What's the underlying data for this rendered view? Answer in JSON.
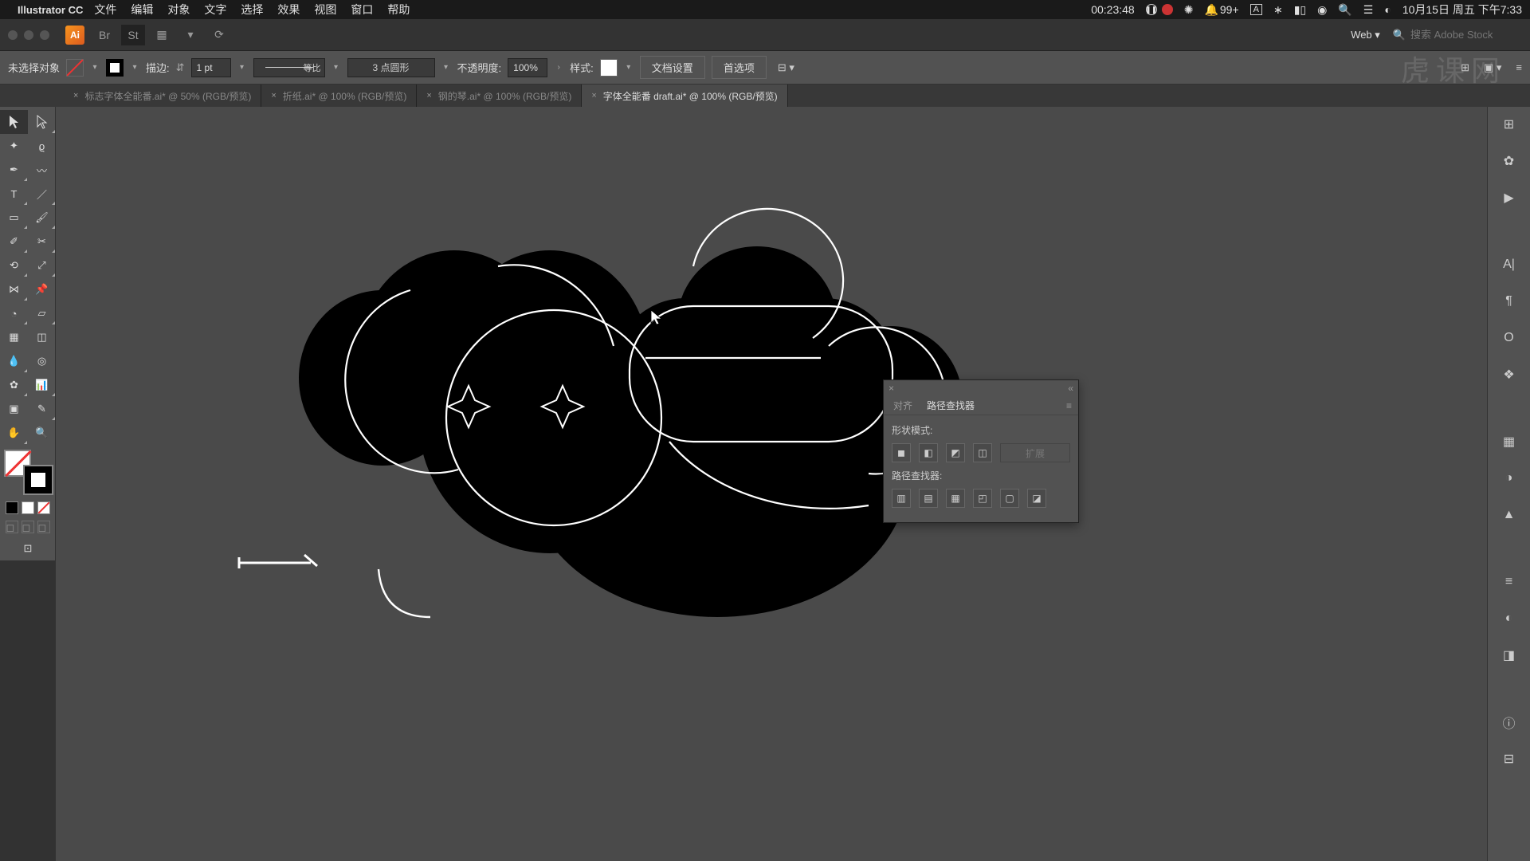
{
  "menubar": {
    "app": "Illustrator CC",
    "items": [
      "文件",
      "编辑",
      "对象",
      "文字",
      "选择",
      "效果",
      "视图",
      "窗口",
      "帮助"
    ],
    "timer": "00:23:48",
    "notif": "99+",
    "date": "10月15日 周五 下午7:33"
  },
  "titlebar": {
    "profile": "Web",
    "search_placeholder": "搜索 Adobe Stock"
  },
  "ctrlbar": {
    "noSelection": "未选择对象",
    "strokeLabel": "描边:",
    "strokeWeight": "1 pt",
    "profileLabel": "等比",
    "brush": "3 点圆形",
    "opacityLabel": "不透明度:",
    "opacity": "100%",
    "styleLabel": "样式:",
    "docSetup": "文档设置",
    "prefs": "首选项"
  },
  "tabs": [
    {
      "label": "标志字体全能番.ai* @ 50% (RGB/预览)",
      "active": false
    },
    {
      "label": "折纸.ai* @ 100% (RGB/预览)",
      "active": false
    },
    {
      "label": "钢的琴.ai* @ 100% (RGB/预览)",
      "active": false
    },
    {
      "label": "字体全能番 draft.ai* @ 100% (RGB/预览)",
      "active": true
    }
  ],
  "pathfinder": {
    "tab_align": "对齐",
    "tab_pf": "路径查找器",
    "shapeModes": "形状模式:",
    "expand": "扩展",
    "pfLabel": "路径查找器:"
  },
  "watermark": "虎课网"
}
